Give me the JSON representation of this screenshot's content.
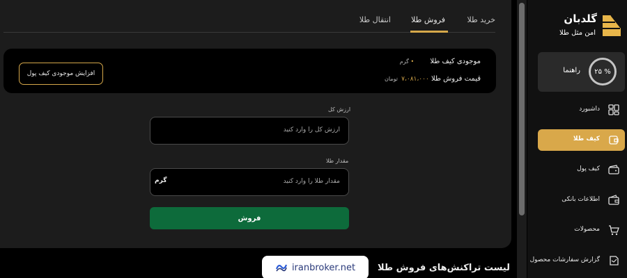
{
  "tabs": [
    {
      "label": "خرید طلا"
    },
    {
      "label": "فروش طلا"
    },
    {
      "label": "انتقال طلا"
    }
  ],
  "wallet": {
    "balance_label": "موجودی کیف طلا",
    "balance_value": "گرم",
    "price_label": "قیمت فروش طلا",
    "price_value": "۷،۰۸۱،۰۰۰",
    "price_unit": "تومان",
    "increase_button": "افزایش موجودی کیف پول"
  },
  "form": {
    "total_label": "ارزش کل",
    "total_placeholder": "ارزش کل را وارد کنید",
    "amount_label": "مقدار طلا",
    "amount_placeholder": "مقدار طلا را وارد کنید",
    "amount_unit": "گرم",
    "sell_button": "فروش"
  },
  "list": {
    "title": "لیست تراکنش‌های فروش طلا"
  },
  "watermark": {
    "text": "iranbroker.net"
  },
  "sidebar": {
    "brand_name": "گلدبان",
    "brand_tagline": "امن مثل طلا",
    "guide": {
      "percent": "۲۵ %",
      "label": "راهنما"
    },
    "items": [
      {
        "label": "داشبورد",
        "icon": "dashboard-icon"
      },
      {
        "label": "کیف طلا",
        "icon": "gold-wallet-icon",
        "active": true
      },
      {
        "label": "کیف پول",
        "icon": "wallet-icon"
      },
      {
        "label": "اطلاعات بانکی",
        "icon": "bank-card-icon"
      },
      {
        "label": "محصولات",
        "icon": "cart-icon"
      },
      {
        "label": "گزارش سفارشات محصول",
        "icon": "report-icon"
      }
    ]
  },
  "colors": {
    "accent": "#d9a84a",
    "sell_green": "#0d6b3b"
  }
}
